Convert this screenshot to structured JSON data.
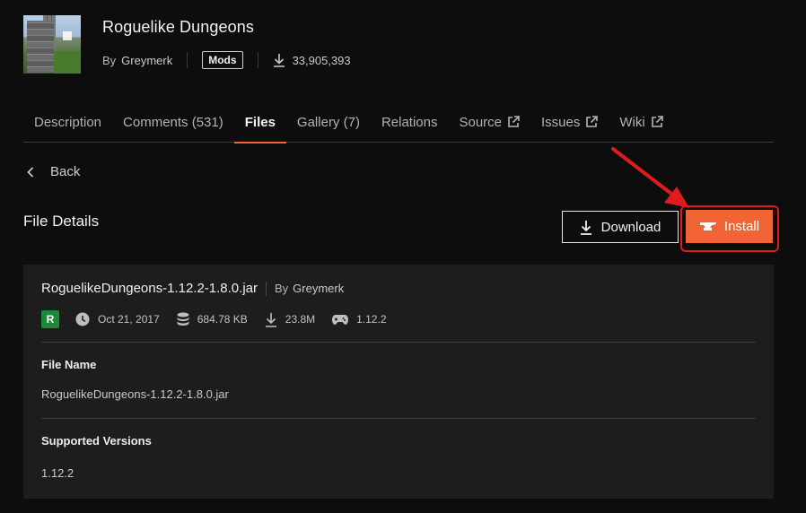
{
  "project": {
    "title": "Roguelike Dungeons",
    "by_label": "By",
    "author": "Greymerk",
    "category_badge": "Mods",
    "downloads": "33,905,393"
  },
  "tabs": [
    {
      "label": "Description",
      "external": false,
      "active": false
    },
    {
      "label": "Comments (531)",
      "external": false,
      "active": false
    },
    {
      "label": "Files",
      "external": false,
      "active": true
    },
    {
      "label": "Gallery (7)",
      "external": false,
      "active": false
    },
    {
      "label": "Relations",
      "external": false,
      "active": false
    },
    {
      "label": "Source",
      "external": true,
      "active": false
    },
    {
      "label": "Issues",
      "external": true,
      "active": false
    },
    {
      "label": "Wiki",
      "external": true,
      "active": false
    }
  ],
  "back_label": "Back",
  "section_title": "File Details",
  "actions": {
    "download_label": "Download",
    "install_label": "Install",
    "install_color": "#f16436",
    "highlight_color": "#e01b1b"
  },
  "file": {
    "name": "RoguelikeDungeons-1.12.2-1.8.0.jar",
    "by_label": "By",
    "author": "Greymerk",
    "release_type": "R",
    "release_color": "#1d8a3a",
    "date": "Oct 21, 2017",
    "size": "684.78 KB",
    "downloads": "23.8M",
    "game_version": "1.12.2",
    "file_name_label": "File Name",
    "file_name_value": "RoguelikeDungeons-1.12.2-1.8.0.jar",
    "supported_label": "Supported Versions",
    "supported_value": "1.12.2"
  }
}
